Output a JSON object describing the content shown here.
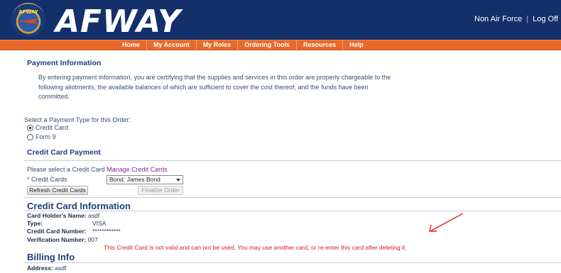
{
  "header": {
    "brand": "AFWAY",
    "seal_text": "AFWAY",
    "links": [
      "Non Air Force",
      "Log Off"
    ],
    "link_separator": "|"
  },
  "nav": {
    "items": [
      "Home",
      "My Account",
      "My Roles",
      "Ordering Tools",
      "Resources",
      "Help"
    ]
  },
  "payment": {
    "title": "Payment Information",
    "statement": "By entering payment information, you are certifying that the supplies and services in this order are properly chargeable to the following allotments, the available balances of which are sufficient to cover the cost thereof, and the funds have been committed.",
    "type_prompt": "Select a Payment Type for this Order:",
    "options": [
      {
        "label": "Credit Card",
        "selected": true
      },
      {
        "label": "Form 9",
        "selected": false
      }
    ]
  },
  "credit_card_payment": {
    "title": "Credit Card Payment",
    "prompt": "Please select a Credit Card",
    "manage_link": "Manage Credit Cards",
    "required_mark": "*",
    "field_label": "Credit Cards",
    "selected_card": "Bond, James Bond",
    "refresh_button": "Refresh Credit Cards",
    "finalize_button": "Finalize Order"
  },
  "card_info": {
    "title": "Credit Card Information",
    "holder_label": "Card Holder's Name:",
    "holder_value": "asdf",
    "type_label": "Type:",
    "type_value": "VISA",
    "number_label": "Credit Card Number:",
    "number_value": "************",
    "verification_label": "Verification Number:",
    "verification_value": "007",
    "error": "This Credit Card is not valid and can not be used. You may use another card, or re-enter this card after deleting it."
  },
  "billing": {
    "title": "Billing Info",
    "address_label": "Address:",
    "address_value": "asdf"
  },
  "colors": {
    "header_bg": "#14306a",
    "nav_bg": "#e86a2a",
    "error": "#d41e1e",
    "link": "#7b2b8f"
  }
}
